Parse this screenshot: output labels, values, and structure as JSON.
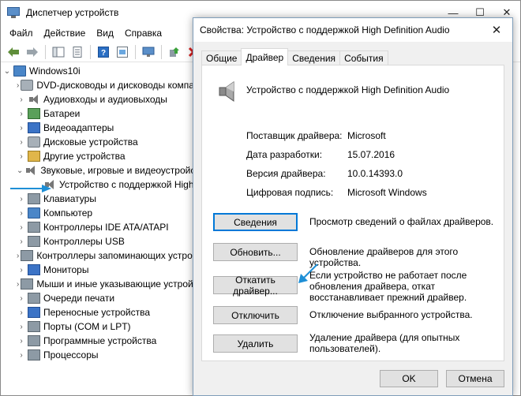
{
  "main_window": {
    "title": "Диспетчер устройств",
    "controls": {
      "minimize": "—",
      "maximize": "☐",
      "close": "✕"
    },
    "menu": [
      "Файл",
      "Действие",
      "Вид",
      "Справка"
    ]
  },
  "tree": {
    "root": "Windows10i",
    "items": [
      "DVD-дисководы и дисководы компакт-дисков",
      "Аудиовходы и аудиовыходы",
      "Батареи",
      "Видеоадаптеры",
      "Дисковые устройства",
      "Другие устройства",
      "Звуковые, игровые и видеоустройства",
      "Устройство с поддержкой High Definition Audio",
      "Клавиатуры",
      "Компьютер",
      "Контроллеры IDE ATA/ATAPI",
      "Контроллеры USB",
      "Контроллеры запоминающих устройств",
      "Мониторы",
      "Мыши и иные указывающие устройства",
      "Очереди печати",
      "Переносные устройства",
      "Порты (COM и LPT)",
      "Программные устройства",
      "Процессоры"
    ]
  },
  "dialog": {
    "title": "Свойства: Устройство с поддержкой High Definition Audio",
    "close": "✕",
    "tabs": [
      "Общие",
      "Драйвер",
      "Сведения",
      "События"
    ],
    "active_tab": "Драйвер",
    "device_name": "Устройство с поддержкой High Definition Audio",
    "info": [
      {
        "key": "Поставщик драйвера:",
        "value": "Microsoft"
      },
      {
        "key": "Дата разработки:",
        "value": "15.07.2016"
      },
      {
        "key": "Версия драйвера:",
        "value": "10.0.14393.0"
      },
      {
        "key": "Цифровая подпись:",
        "value": "Microsoft Windows"
      }
    ],
    "buttons": [
      {
        "label": "Сведения",
        "desc": "Просмотр сведений о файлах драйверов."
      },
      {
        "label": "Обновить...",
        "desc": "Обновление драйверов для этого устройства."
      },
      {
        "label": "Откатить драйвер...",
        "desc": "Если устройство не работает после обновления драйвера, откат восстанавливает прежний драйвер."
      },
      {
        "label": "Отключить",
        "desc": "Отключение выбранного устройства."
      },
      {
        "label": "Удалить",
        "desc": "Удаление драйвера (для опытных пользователей)."
      }
    ],
    "ok": "OK",
    "cancel": "Отмена"
  },
  "colors": {
    "accent": "#0078d7",
    "arrow": "#1e8fd6"
  }
}
